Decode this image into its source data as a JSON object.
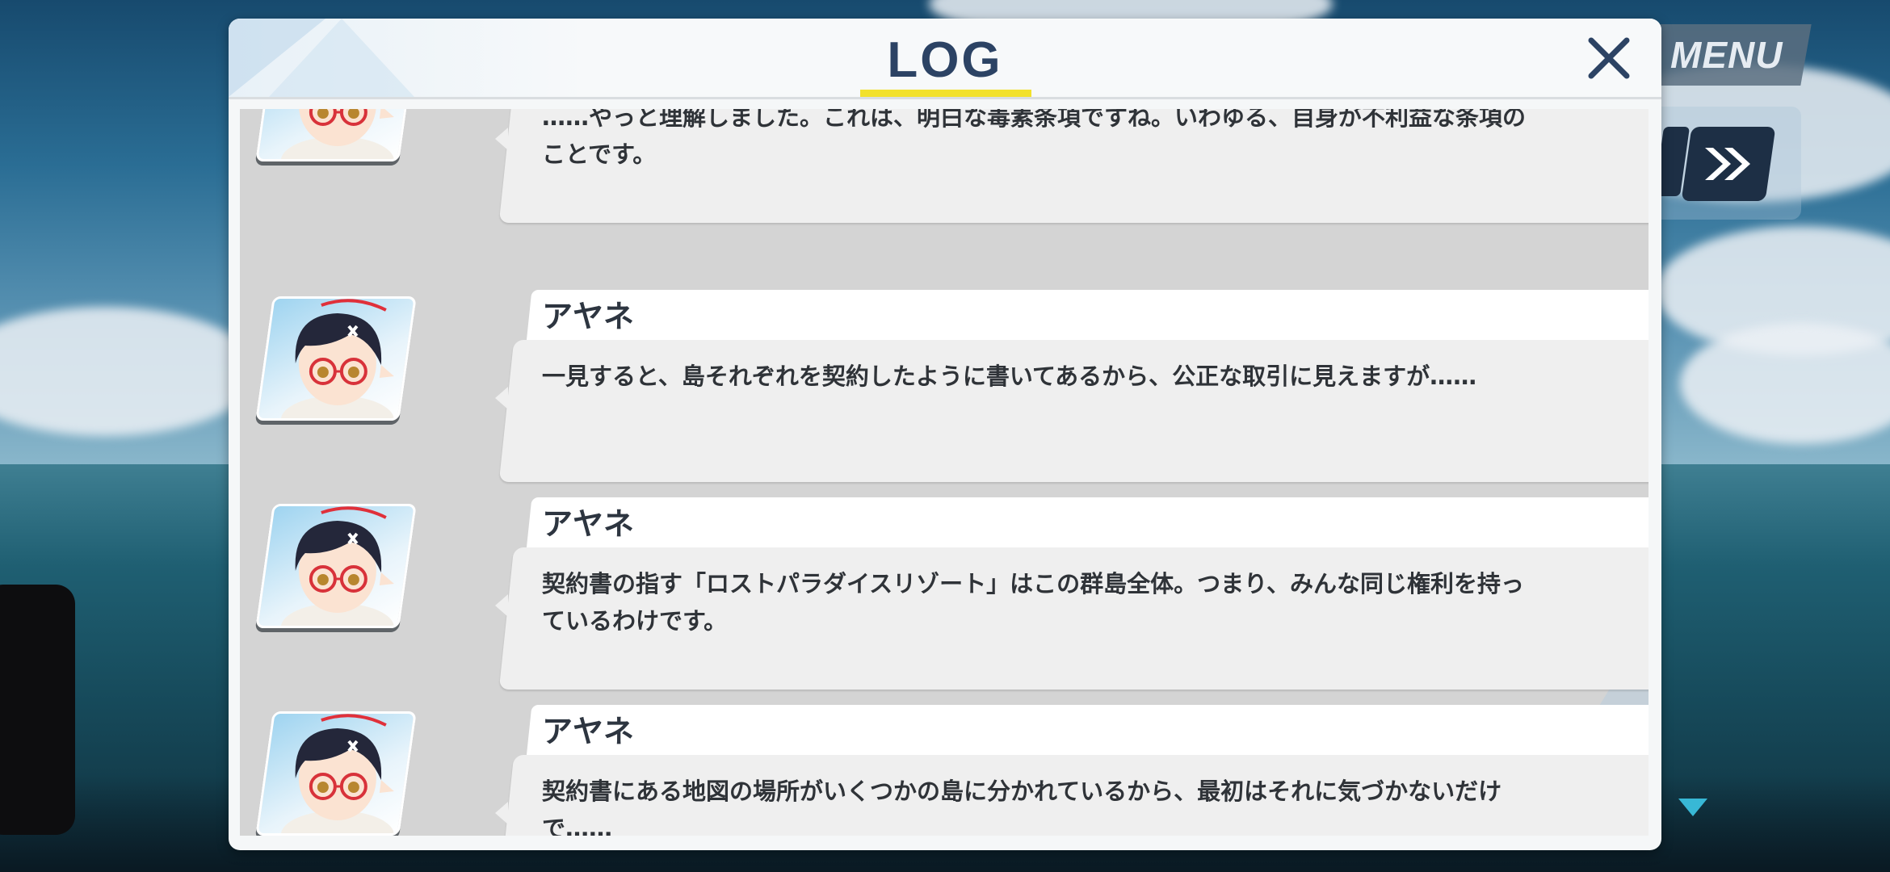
{
  "hud": {
    "menu_label": "MENU"
  },
  "log": {
    "title": "LOG",
    "entries": [
      {
        "name": "",
        "text": "……やっと理解しました。これは、明白な毒素条項ですね。いわゆる、自身が不利益な条項の\nことです。"
      },
      {
        "name": "アヤネ",
        "text": "一見すると、島それぞれを契約したように書いてあるから、公正な取引に見えますが……"
      },
      {
        "name": "アヤネ",
        "text": "契約書の指す「ロストパラダイスリゾート」はこの群島全体。つまり、みんな同じ権利を持っ\nているわけです。"
      },
      {
        "name": "アヤネ",
        "text": "契約書にある地図の場所がいくつかの島に分かれているから、最初はそれに気づかないだけ\nで……"
      }
    ]
  },
  "colors": {
    "title": "#2c4364",
    "underline": "#f2e12c",
    "hud_button": "#1d2f45",
    "indicator": "#38b8d6"
  },
  "icons": {
    "close": "close-icon",
    "skip": "fast-forward-icon",
    "scroll": "down-arrow-icon"
  }
}
